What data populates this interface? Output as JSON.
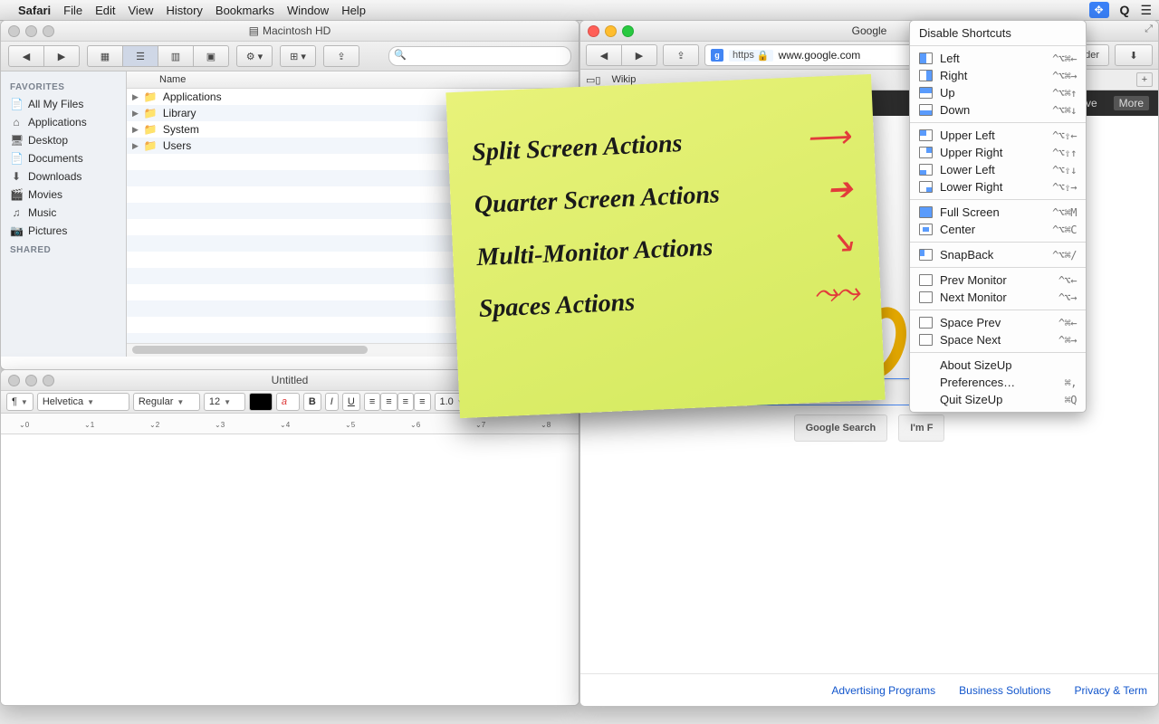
{
  "menubar": {
    "app": "Safari",
    "items": [
      "File",
      "Edit",
      "View",
      "History",
      "Bookmarks",
      "Window",
      "Help"
    ]
  },
  "finder": {
    "title": "Macintosh HD",
    "column_header": "Name",
    "sidebar": {
      "favorites_header": "FAVORITES",
      "shared_header": "SHARED",
      "items": [
        {
          "icon": "📄",
          "label": "All My Files"
        },
        {
          "icon": "⌂",
          "label": "Applications"
        },
        {
          "icon": "🖥",
          "label": "Desktop"
        },
        {
          "icon": "📄",
          "label": "Documents"
        },
        {
          "icon": "⬇",
          "label": "Downloads"
        },
        {
          "icon": "🎬",
          "label": "Movies"
        },
        {
          "icon": "♫",
          "label": "Music"
        },
        {
          "icon": "📷",
          "label": "Pictures"
        }
      ]
    },
    "rows": [
      "Applications",
      "Library",
      "System",
      "Users"
    ]
  },
  "textedit": {
    "title": "Untitled",
    "font_family": "Helvetica",
    "font_style": "Regular",
    "font_size": "12",
    "line_spacing": "1.0"
  },
  "safari": {
    "title": "Google",
    "url_scheme": "https",
    "url": "www.google.com",
    "reader_label": "Reader",
    "fav_items": [
      "Wikip"
    ],
    "gbar": [
      "Drive",
      "More"
    ],
    "search_btn": "Google Search",
    "lucky_btn": "I'm F",
    "footer": [
      "Advertising Programs",
      "Business Solutions",
      "Privacy & Term"
    ]
  },
  "sizeup": {
    "title": "Disable Shortcuts",
    "items": [
      {
        "pic": "left",
        "label": "Left",
        "sc": "^⌥⌘←"
      },
      {
        "pic": "right",
        "label": "Right",
        "sc": "^⌥⌘→"
      },
      {
        "pic": "up",
        "label": "Up",
        "sc": "^⌥⌘↑"
      },
      {
        "pic": "down",
        "label": "Down",
        "sc": "^⌥⌘↓"
      },
      "sep",
      {
        "pic": "ul",
        "label": "Upper Left",
        "sc": "^⌥⇧←"
      },
      {
        "pic": "ur",
        "label": "Upper Right",
        "sc": "^⌥⇧↑"
      },
      {
        "pic": "ll",
        "label": "Lower Left",
        "sc": "^⌥⇧↓"
      },
      {
        "pic": "lr",
        "label": "Lower Right",
        "sc": "^⌥⇧→"
      },
      "sep",
      {
        "pic": "full",
        "label": "Full Screen",
        "sc": "^⌥⌘M"
      },
      {
        "pic": "center",
        "label": "Center",
        "sc": "^⌥⌘C"
      },
      "sep",
      {
        "pic": "snap",
        "label": "SnapBack",
        "sc": "^⌥⌘/"
      },
      "sep",
      {
        "pic": "mon",
        "label": "Prev Monitor",
        "sc": "^⌥←"
      },
      {
        "pic": "mon",
        "label": "Next Monitor",
        "sc": "^⌥→"
      },
      "sep",
      {
        "pic": "sp",
        "label": "Space Prev",
        "sc": "^⌘←"
      },
      {
        "pic": "sp",
        "label": "Space Next",
        "sc": "^⌘→"
      },
      "sep",
      {
        "label": "About SizeUp",
        "sc": ""
      },
      {
        "label": "Preferences…",
        "sc": "⌘,"
      },
      {
        "label": "Quit SizeUp",
        "sc": "⌘Q"
      }
    ]
  },
  "sticky": {
    "lines": [
      "Split Screen Actions",
      "Quarter Screen Actions",
      "Multi-Monitor Actions",
      "Spaces Actions"
    ]
  }
}
